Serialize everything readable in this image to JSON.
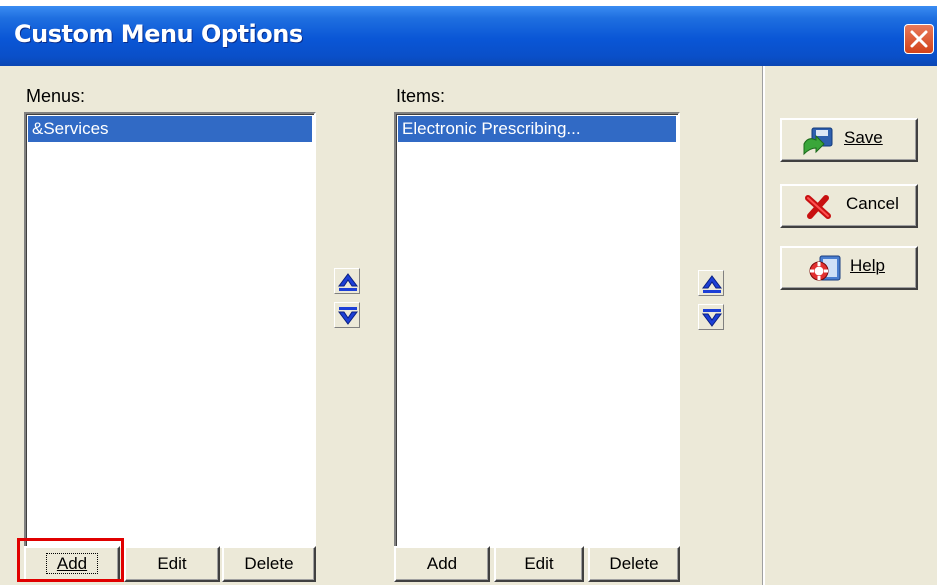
{
  "window": {
    "title": "Custom Menu Options"
  },
  "menus": {
    "label": "Menus:",
    "items": [
      "&Services"
    ]
  },
  "items": {
    "label": "Items:",
    "items": [
      "Electronic Prescribing..."
    ]
  },
  "menu_buttons": {
    "add": "Add",
    "edit": "Edit",
    "delete": "Delete"
  },
  "item_buttons": {
    "add": "Add",
    "edit": "Edit",
    "delete": "Delete"
  },
  "side_buttons": {
    "save": "Save",
    "cancel": "Cancel",
    "help": "Help"
  },
  "colors": {
    "titlebar": "#0a56d6",
    "selection": "#316ac5",
    "highlight_box": "#e00000",
    "arrow": "#1c3fd6"
  },
  "icons": [
    "close-icon",
    "save-icon",
    "cancel-icon",
    "help-icon",
    "arrow-up-icon",
    "arrow-down-icon"
  ]
}
